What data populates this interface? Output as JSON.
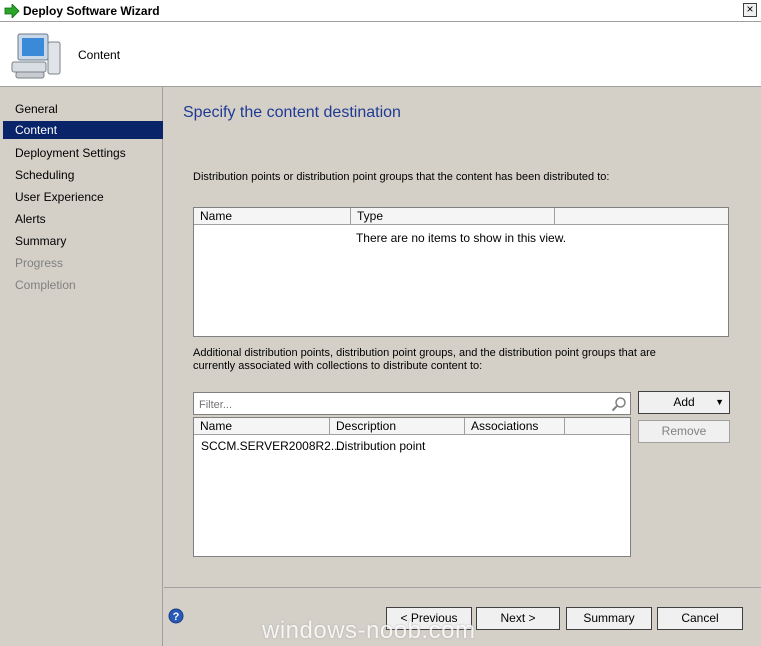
{
  "window": {
    "title": "Deploy Software Wizard",
    "close_glyph": "×"
  },
  "header": {
    "page_label": "Content"
  },
  "sidebar": {
    "items": [
      {
        "label": "General"
      },
      {
        "label": "Content"
      },
      {
        "label": "Deployment Settings"
      },
      {
        "label": "Scheduling"
      },
      {
        "label": "User Experience"
      },
      {
        "label": "Alerts"
      },
      {
        "label": "Summary"
      },
      {
        "label": "Progress"
      },
      {
        "label": "Completion"
      }
    ],
    "active_index": 1
  },
  "main": {
    "heading": "Specify the content destination",
    "distributed_label": "Distribution points or distribution point groups that the content has been distributed to:",
    "distributed_list": {
      "columns": [
        "Name",
        "Type"
      ],
      "empty_message": "There are no items to show in this view."
    },
    "additional_label": "Additional distribution points, distribution point groups, and the distribution point groups that are currently associated with collections to distribute content to:",
    "filter": {
      "placeholder": "Filter..."
    },
    "additional_list": {
      "columns": [
        "Name",
        "Description",
        "Associations"
      ],
      "rows": [
        {
          "name": "SCCM.SERVER2008R2....",
          "description": "Distribution point",
          "associations": ""
        }
      ]
    },
    "add_label": "Add",
    "remove_label": "Remove"
  },
  "footer": {
    "previous_label": "< Previous",
    "next_label": "Next >",
    "summary_label": "Summary",
    "cancel_label": "Cancel"
  },
  "watermark": "windows-noob.com",
  "colors": {
    "selection": "#0a246a",
    "heading": "#1f3a93",
    "background": "#d4d0c8"
  }
}
